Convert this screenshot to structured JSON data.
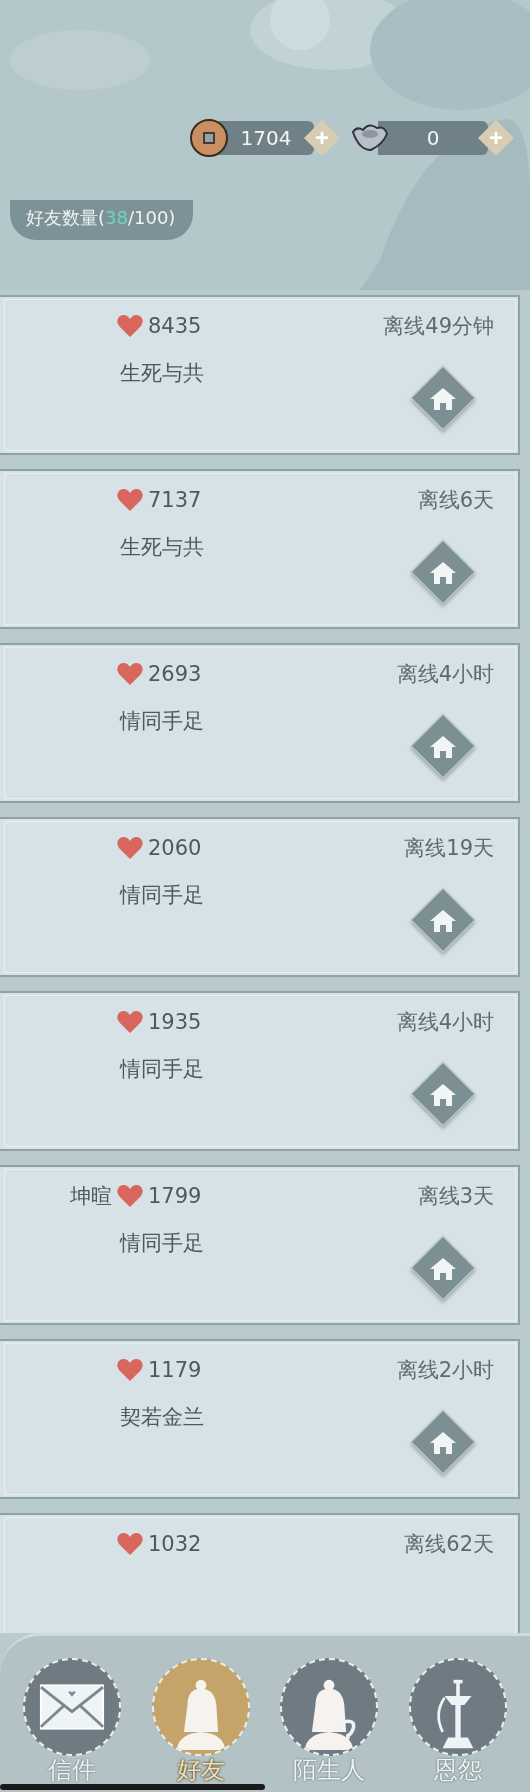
{
  "currencies": [
    {
      "kind": "coin",
      "amount": "1704",
      "add": "+"
    },
    {
      "kind": "silver",
      "amount": "0",
      "add": "+"
    }
  ],
  "friend_count": {
    "label": "好友数量(",
    "current": "38",
    "rest": "/100)"
  },
  "friends": [
    {
      "intimacy": "8435",
      "status": "离线49分钟",
      "relation": "生死与共"
    },
    {
      "intimacy": "7137",
      "status": "离线6天",
      "relation": "生死与共"
    },
    {
      "intimacy": "2693",
      "status": "离线4小时",
      "relation": "情同手足"
    },
    {
      "intimacy": "2060",
      "status": "离线19天",
      "relation": "情同手足"
    },
    {
      "intimacy": "1935",
      "status": "离线4小时",
      "relation": "情同手足"
    },
    {
      "name": "坤暄",
      "intimacy": "1799",
      "status": "离线3天",
      "relation": "情同手足"
    },
    {
      "intimacy": "1179",
      "status": "离线2小时",
      "relation": "契若金兰"
    },
    {
      "intimacy": "1032",
      "status": "离线62天"
    }
  ],
  "tabs": [
    {
      "kind": "mail",
      "label": "信件",
      "selected": false
    },
    {
      "kind": "friend",
      "label": "好友",
      "selected": true
    },
    {
      "kind": "stranger",
      "label": "陌生人",
      "selected": false
    },
    {
      "kind": "feud",
      "label": "恩怨",
      "selected": false
    }
  ]
}
